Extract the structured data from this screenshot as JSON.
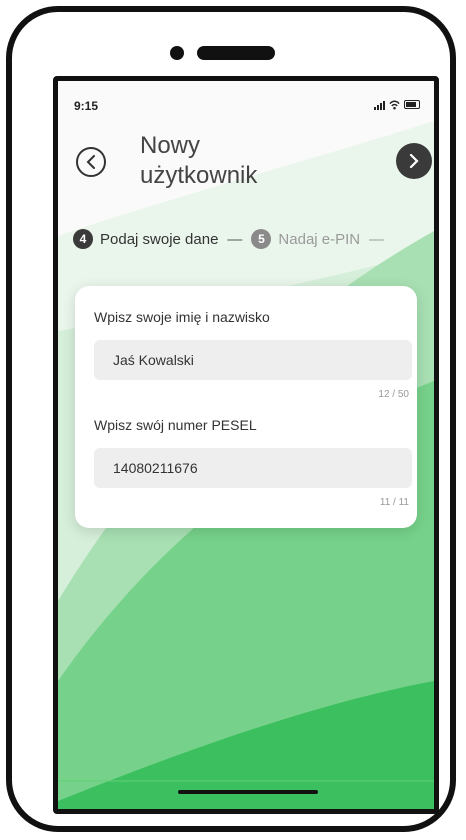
{
  "status_bar": {
    "time": "9:15"
  },
  "header": {
    "title_line1": "Nowy",
    "title_line2": "użytkownik"
  },
  "stepper": [
    {
      "number": "4",
      "label": "Podaj swoje dane",
      "active": true
    },
    {
      "number": "5",
      "label": "Nadaj e-PIN",
      "active": false
    }
  ],
  "form": {
    "name_field": {
      "label": "Wpisz swoje imię i nazwisko",
      "value": "Jaś Kowalski",
      "counter": "12 / 50"
    },
    "pesel_field": {
      "label": "Wpisz swój numer PESEL",
      "value": "14080211676",
      "counter": "11 / 11"
    }
  },
  "colors": {
    "accent_green": "#3cbf5e",
    "button_dark": "#3a3a3a"
  }
}
